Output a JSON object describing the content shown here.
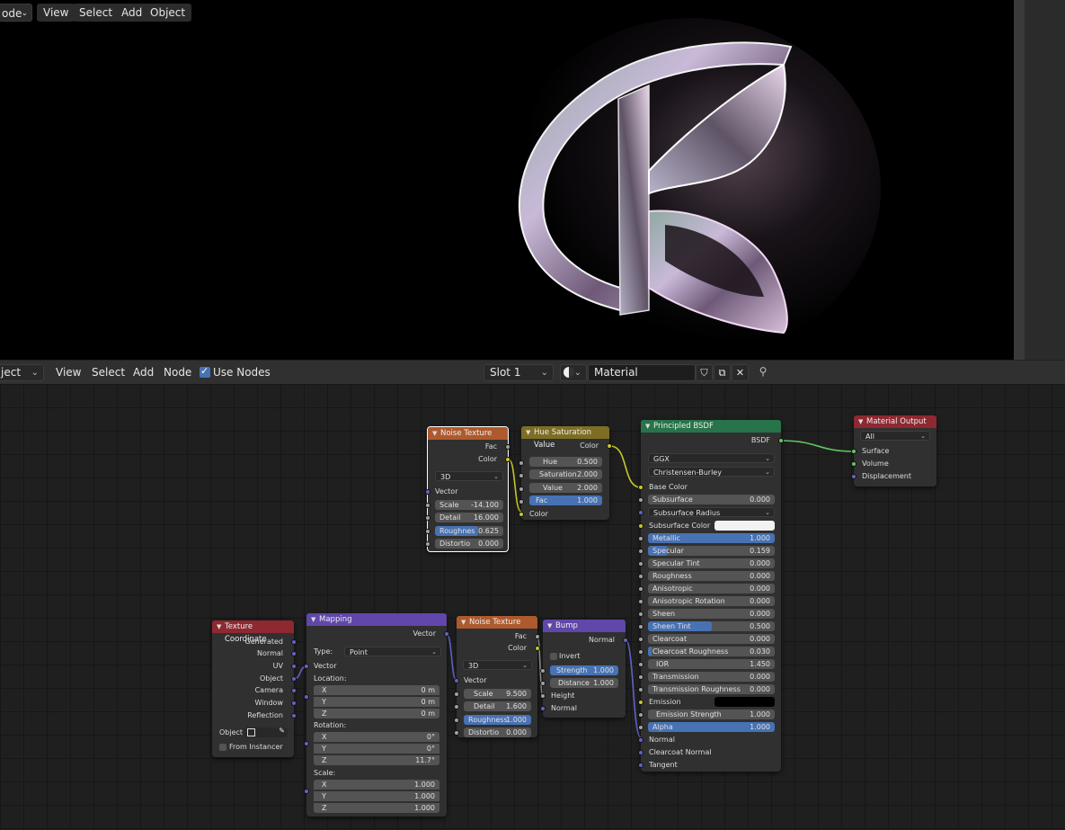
{
  "viewport": {
    "mode_label": "ode",
    "menu": [
      "View",
      "Select",
      "Add",
      "Object"
    ]
  },
  "editor_header": {
    "mode_label": "ject",
    "menu": [
      "View",
      "Select",
      "Add",
      "Node"
    ],
    "use_nodes_label": "Use Nodes",
    "use_nodes_checked": true,
    "slot_label": "Slot 1",
    "material_name": "Material",
    "icons": [
      "material-sphere-icon",
      "fake-user-shield-icon",
      "duplicate-icon",
      "close-icon",
      "pin-icon"
    ]
  },
  "nodes": {
    "noise1": {
      "title": "Noise Texture",
      "outputs": [
        "Fac",
        "Color"
      ],
      "dimensions": "3D",
      "vector_label": "Vector",
      "scale_label": "Scale",
      "scale_value": "-14.100",
      "detail_label": "Detail",
      "detail_value": "16.000",
      "roughness_label": "Roughnes",
      "roughness_value": "0.625",
      "distortion_label": "Distortio",
      "distortion_value": "0.000"
    },
    "hsv": {
      "title": "Hue Saturation Value",
      "output": "Color",
      "hue_label": "Hue",
      "hue_value": "0.500",
      "saturation_label": "Saturation",
      "saturation_value": "2.000",
      "value_label": "Value",
      "value_value": "2.000",
      "fac_label": "Fac",
      "fac_value": "1.000",
      "color_label": "Color"
    },
    "bsdf": {
      "title": "Principled BSDF",
      "output": "BSDF",
      "distribution": "GGX",
      "subsurface_method": "Christensen-Burley",
      "base_color": "Base Color",
      "subsurface": {
        "label": "Subsurface",
        "value": "0.000"
      },
      "subsurface_radius": "Subsurface Radius",
      "subsurface_color": "Subsurface Color",
      "metallic": {
        "label": "Metallic",
        "value": "1.000"
      },
      "specular": {
        "label": "Specular",
        "value": "0.159"
      },
      "specular_tint": {
        "label": "Specular Tint",
        "value": "0.000"
      },
      "roughness": {
        "label": "Roughness",
        "value": "0.000"
      },
      "anisotropic": {
        "label": "Anisotropic",
        "value": "0.000"
      },
      "anisotropic_rotation": {
        "label": "Anisotropic Rotation",
        "value": "0.000"
      },
      "sheen": {
        "label": "Sheen",
        "value": "0.000"
      },
      "sheen_tint": {
        "label": "Sheen Tint",
        "value": "0.500"
      },
      "clearcoat": {
        "label": "Clearcoat",
        "value": "0.000"
      },
      "clearcoat_roughness": {
        "label": "Clearcoat Roughness",
        "value": "0.030"
      },
      "ior": {
        "label": "IOR",
        "value": "1.450"
      },
      "transmission": {
        "label": "Transmission",
        "value": "0.000"
      },
      "transmission_roughness": {
        "label": "Transmission Roughness",
        "value": "0.000"
      },
      "emission": "Emission",
      "emission_strength": {
        "label": "Emission Strength",
        "value": "1.000"
      },
      "alpha": {
        "label": "Alpha",
        "value": "1.000"
      },
      "normal": "Normal",
      "clearcoat_normal": "Clearcoat Normal",
      "tangent": "Tangent"
    },
    "output": {
      "title": "Material Output",
      "target": "All",
      "inputs": [
        "Surface",
        "Volume",
        "Displacement"
      ]
    },
    "texcoord": {
      "title": "Texture Coordinate",
      "outputs": [
        "Generated",
        "Normal",
        "UV",
        "Object",
        "Camera",
        "Window",
        "Reflection"
      ],
      "object_label": "Object",
      "from_instancer": "From Instancer"
    },
    "mapping": {
      "title": "Mapping",
      "output": "Vector",
      "type_label": "Type:",
      "type_value": "Point",
      "vector_label": "Vector",
      "location_label": "Location:",
      "location": [
        {
          "axis": "X",
          "value": "0 m"
        },
        {
          "axis": "Y",
          "value": "0 m"
        },
        {
          "axis": "Z",
          "value": "0 m"
        }
      ],
      "rotation_label": "Rotation:",
      "rotation": [
        {
          "axis": "X",
          "value": "0°"
        },
        {
          "axis": "Y",
          "value": "0°"
        },
        {
          "axis": "Z",
          "value": "11.7°"
        }
      ],
      "scale_label": "Scale:",
      "scale": [
        {
          "axis": "X",
          "value": "1.000"
        },
        {
          "axis": "Y",
          "value": "1.000"
        },
        {
          "axis": "Z",
          "value": "1.000"
        }
      ]
    },
    "noise2": {
      "title": "Noise Texture",
      "outputs": [
        "Fac",
        "Color"
      ],
      "dimensions": "3D",
      "vector_label": "Vector",
      "scale_label": "Scale",
      "scale_value": "9.500",
      "detail_label": "Detail",
      "detail_value": "1.600",
      "roughness_label": "Roughness",
      "roughness_value": "1.000",
      "distortion_label": "Distortio",
      "distortion_value": "0.000"
    },
    "bump": {
      "title": "Bump",
      "output": "Normal",
      "invert_label": "Invert",
      "strength_label": "Strength",
      "strength_value": "1.000",
      "distance_label": "Distance",
      "distance_value": "1.000",
      "height_label": "Height",
      "normal_label": "Normal"
    }
  },
  "colors": {
    "texture_header": "#ae5a2e",
    "color_header": "#7d6e24",
    "shader_header": "#27744a",
    "output_header": "#8e2831",
    "vector_header": "#6047a9",
    "slider_blue": "#4772b3"
  }
}
